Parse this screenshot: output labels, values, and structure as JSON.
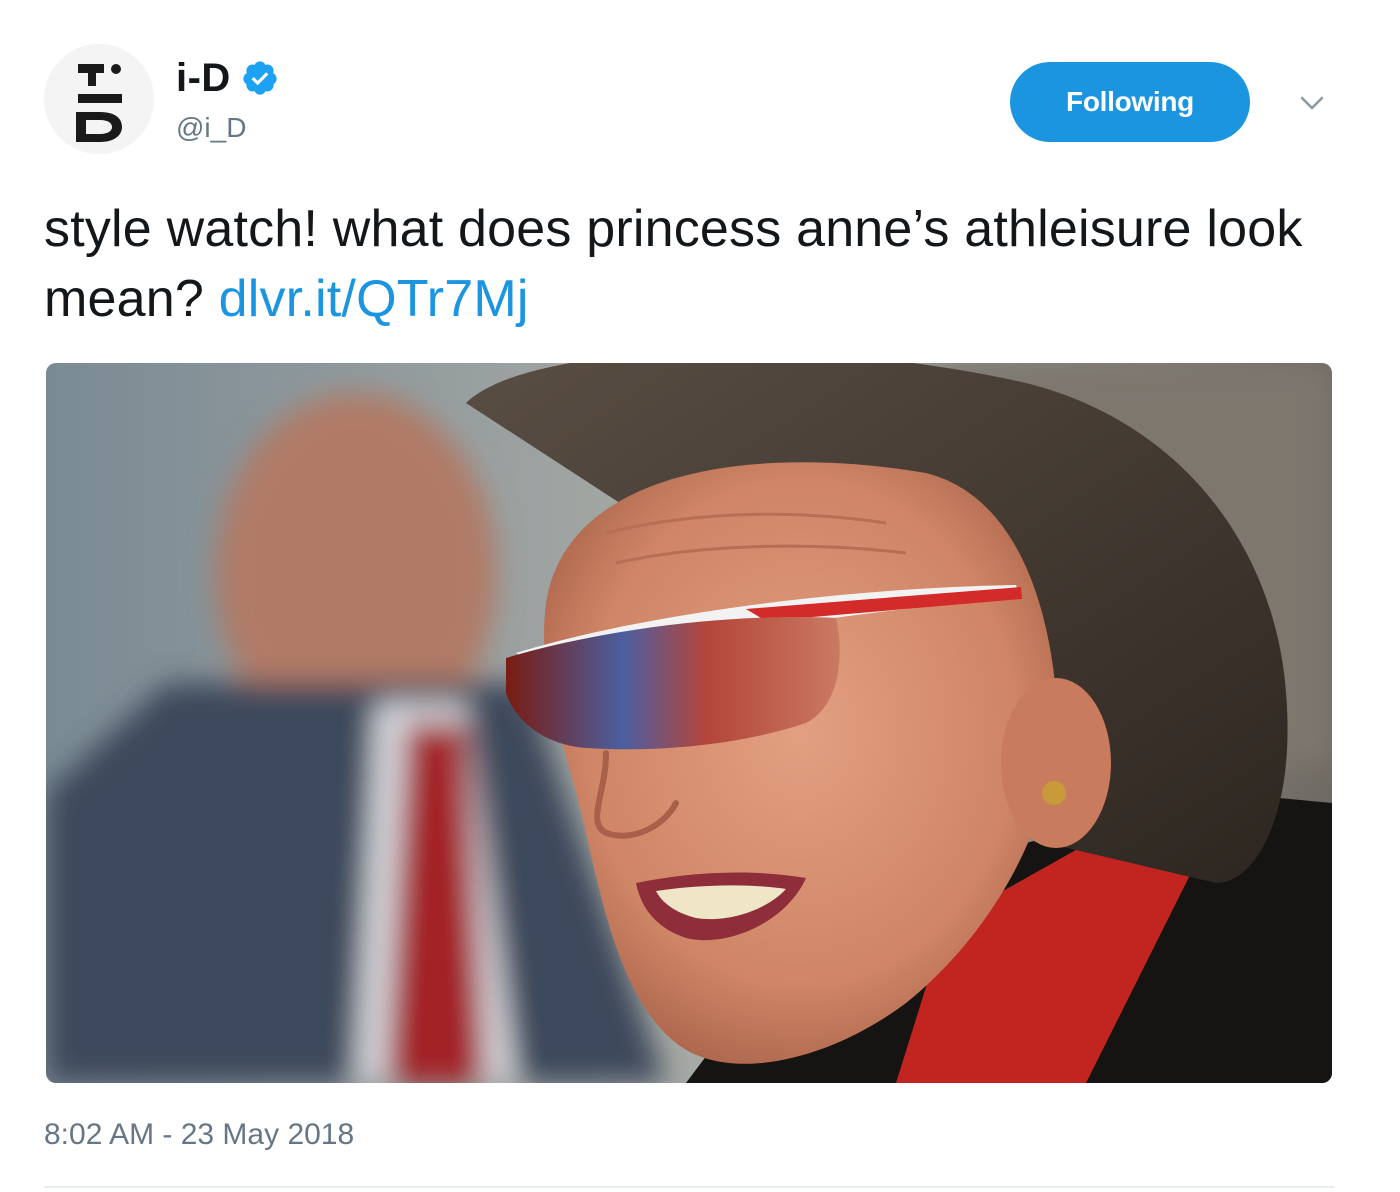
{
  "account": {
    "display_name": "i-D",
    "handle": "@i_D",
    "verified": true,
    "avatar_logo": "i-D logo"
  },
  "actions": {
    "follow_label": "Following",
    "more_icon": "chevron-down"
  },
  "tweet": {
    "text": "style watch! what does princess anne’s athleisure look mean? ",
    "link": "dlvr.it/QTr7Mj",
    "timestamp": "8:02 AM - 23 May 2018"
  },
  "colors": {
    "accent": "#1b95e0",
    "text": "#14171a",
    "muted": "#657786"
  }
}
